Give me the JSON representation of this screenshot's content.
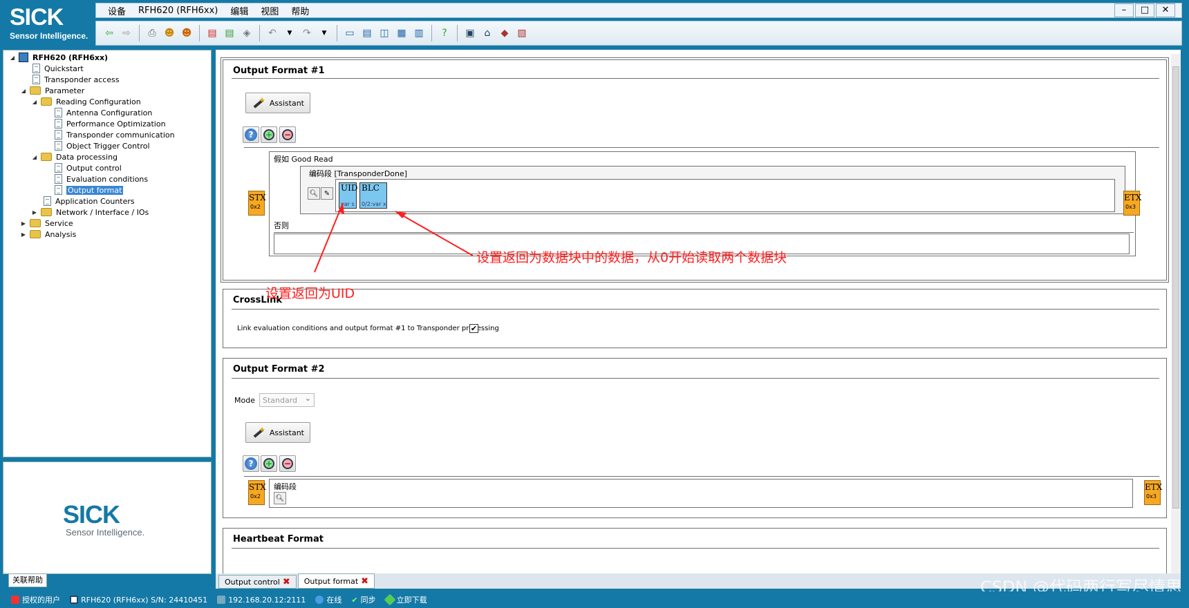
{
  "brand": {
    "name": "SICK",
    "tagline": "Sensor Intelligence."
  },
  "menu": [
    "设备",
    "RFH620 (RFH6xx)",
    "编辑",
    "视图",
    "帮助"
  ],
  "window_controls": [
    "minimize",
    "maximize",
    "close"
  ],
  "toolbar_icons": [
    "back-icon",
    "forward-icon",
    "print-icon",
    "user-login-icon",
    "users-icon",
    "export-icon",
    "import-icon",
    "eraser-icon",
    "undo-icon",
    "redo-icon",
    "layout-1-icon",
    "layout-2-icon",
    "layout-3-icon",
    "layout-4-icon",
    "layout-5-icon",
    "help-icon",
    "monitor-icon",
    "home-icon",
    "device-icon",
    "report-icon"
  ],
  "tree": {
    "root": "RFH620 (RFH6xx)",
    "quickstart": "Quickstart",
    "transponder_access": "Transponder access",
    "parameter": "Parameter",
    "reading_configuration": "Reading Configuration",
    "antenna_configuration": "Antenna Configuration",
    "performance_optimization": "Performance Optimization",
    "transponder_communication": "Transponder communication",
    "object_trigger_control": "Object Trigger Control",
    "data_processing": "Data processing",
    "output_control": "Output control",
    "evaluation_conditions": "Evaluation conditions",
    "output_format": "Output format",
    "application_counters": "Application Counters",
    "network": "Network / Interface / IOs",
    "service": "Service",
    "analysis": "Analysis"
  },
  "help_tab": "关联帮助",
  "output_format_1": {
    "title": "Output Format #1",
    "assistant_label": "Assistant",
    "if_label": "假如 Good Read",
    "block_label": "编码段 [TransponderDone]",
    "else_label": "否则",
    "stx": {
      "name": "STX",
      "code": "0x2"
    },
    "etx": {
      "name": "ETX",
      "code": "0x3"
    },
    "fields": [
      {
        "name": "UID",
        "sub": "var s"
      },
      {
        "name": "BLC",
        "sub": "0/2:var x"
      }
    ]
  },
  "crosslink": {
    "title": "CrossLink",
    "label": "Link evaluation conditions and output format #1 to Transponder processing",
    "checked": "✔"
  },
  "output_format_2": {
    "title": "Output Format #2",
    "mode_label": "Mode",
    "mode_value": "Standard",
    "assistant_label": "Assistant",
    "block_label": "编码段",
    "stx": {
      "name": "STX",
      "code": "0x2"
    },
    "etx": {
      "name": "ETX",
      "code": "0x3"
    }
  },
  "heartbeat": {
    "title": "Heartbeat Format"
  },
  "annotations": {
    "uid_note": "设置返回为UID",
    "blc_note": "设置返回为数据块中的数据，从0开始读取两个数据块"
  },
  "tabs": [
    {
      "label": "Output control",
      "active": false
    },
    {
      "label": "Output format",
      "active": true
    }
  ],
  "status": {
    "user": "授权的用户",
    "device": "RFH620 (RFH6xx) S/N: 24410451",
    "ip": "192.168.20.12:2111",
    "online": "在线",
    "sync": "同步",
    "download": "立即下载"
  },
  "watermark": "CSDN @代码两行写尽情思",
  "colors": {
    "brand_blue": "#1479a6",
    "stx_orange": "#f7a823",
    "field_blue": "#7cc7ef",
    "annotation_red": "#ff1f1f"
  }
}
